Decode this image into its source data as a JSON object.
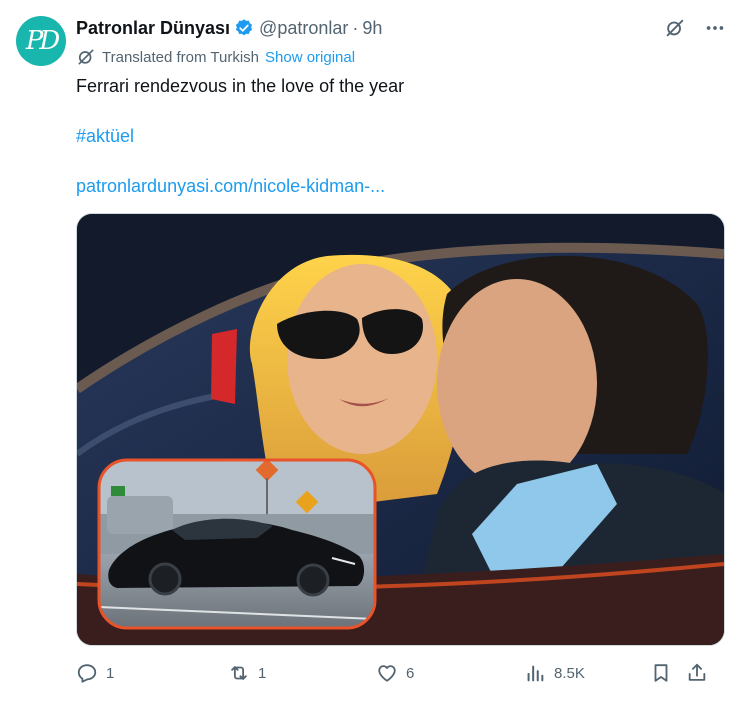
{
  "author": {
    "name": "Patronlar Dünyası",
    "handle": "@patronlar",
    "separator": "·",
    "time": "9h",
    "avatar_initials": "PD"
  },
  "translation": {
    "label": "Translated from Turkish",
    "show_original": "Show original"
  },
  "body": {
    "text": "Ferrari rendezvous in the love of the year",
    "hashtag": "#aktüel",
    "link": "patronlardunyasi.com/nicole-kidman-..."
  },
  "actions": {
    "replies": "1",
    "reposts": "1",
    "likes": "6",
    "views": "8.5K"
  },
  "icons": {
    "verified": "verified-badge-icon",
    "grok": "grok-icon",
    "more": "more-icon",
    "translate": "translate-icon",
    "reply": "reply-icon",
    "repost": "repost-icon",
    "like": "like-icon",
    "views": "views-icon",
    "bookmark": "bookmark-icon",
    "share": "share-icon"
  },
  "colors": {
    "accent": "#1d9bf0",
    "secondary_text": "#536471",
    "avatar": "#19b6ad",
    "inset_border": "#e8532a"
  }
}
